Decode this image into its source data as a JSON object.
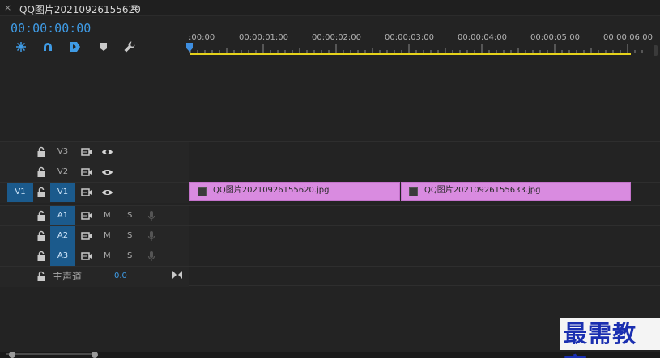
{
  "tab": {
    "close": "×",
    "title": "QQ图片20210926155620",
    "menu": "≡"
  },
  "timecode": "00:00:00:00",
  "tools": [
    "snap-icon",
    "linked-selection-icon",
    "insert-marker-icon",
    "add-marker-icon",
    "wrench-icon"
  ],
  "ruler": {
    "labels": [
      ":00:00",
      "00:00:01:00",
      "00:00:02:00",
      "00:00:03:00",
      "00:00:04:00",
      "00:00:05:00",
      "00:00:06:00"
    ]
  },
  "tracks": {
    "v3": {
      "name": "V3"
    },
    "v2": {
      "name": "V2"
    },
    "v1": {
      "name": "V1",
      "source": "V1"
    },
    "a1": {
      "name": "A1",
      "mute": "M",
      "solo": "S"
    },
    "a2": {
      "name": "A2",
      "mute": "M",
      "solo": "S"
    },
    "a3": {
      "name": "A3",
      "mute": "M",
      "solo": "S"
    },
    "master": {
      "name": "主声道",
      "value": "0.0"
    }
  },
  "clips": [
    {
      "name": "QQ图片20210926155620.jpg"
    },
    {
      "name": "QQ图片20210926155633.jpg"
    }
  ],
  "colors": {
    "accent": "#3f9be5",
    "clip": "#d98be0",
    "workarea": "#e6d21a",
    "track_target": "#1b5a8c"
  },
  "watermark": "最需教育"
}
